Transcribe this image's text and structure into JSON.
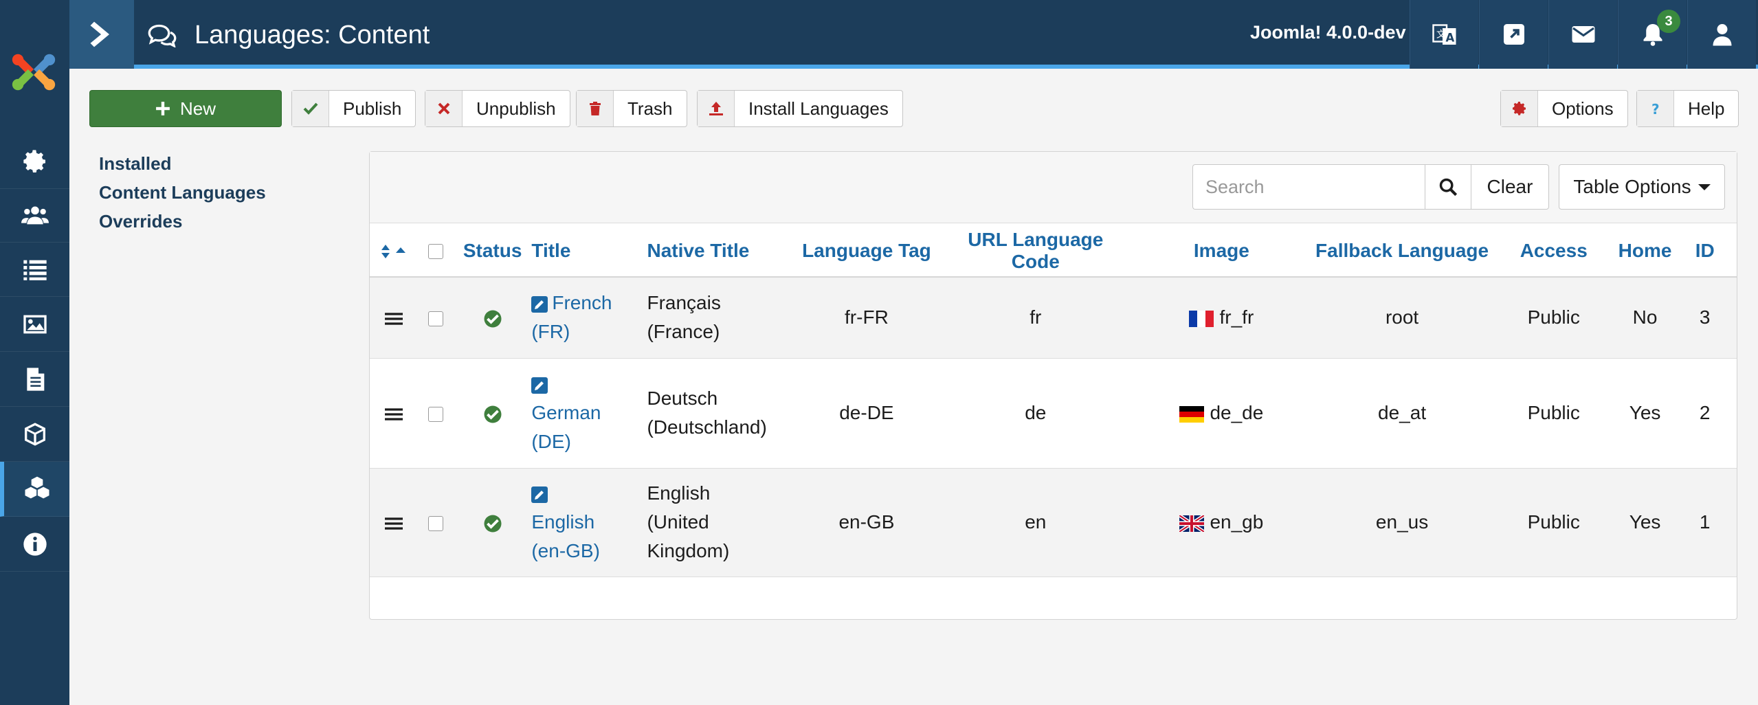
{
  "header": {
    "title": "Languages: Content",
    "version": "Joomla! 4.0.0-dev",
    "notification_count": "3",
    "accent_color": "#4aa6e8",
    "bg_color": "#1c3d5a"
  },
  "sidebar": {
    "items": [
      {
        "icon": "gear-icon"
      },
      {
        "icon": "users-icon"
      },
      {
        "icon": "list-icon"
      },
      {
        "icon": "image-icon"
      },
      {
        "icon": "document-icon"
      },
      {
        "icon": "cube-icon"
      },
      {
        "icon": "cubes-icon",
        "active": true
      },
      {
        "icon": "info-icon"
      }
    ]
  },
  "toolbar": {
    "new_label": "New",
    "publish_label": "Publish",
    "unpublish_label": "Unpublish",
    "trash_label": "Trash",
    "install_label": "Install Languages",
    "options_label": "Options",
    "help_label": "Help"
  },
  "submenu": {
    "installed": "Installed",
    "content_languages": "Content Languages",
    "overrides": "Overrides"
  },
  "filters": {
    "search_placeholder": "Search",
    "clear_label": "Clear",
    "table_options_label": "Table Options"
  },
  "table": {
    "headers": {
      "status": "Status",
      "title": "Title",
      "native_title": "Native Title",
      "language_tag": "Language Tag",
      "url_code": "URL Language Code",
      "image": "Image",
      "fallback": "Fallback Language",
      "access": "Access",
      "home": "Home",
      "id": "ID"
    },
    "rows": [
      {
        "title_line1": "French",
        "title_line2": "(FR)",
        "native_line1": "Français",
        "native_line2": "(France)",
        "native_line3": "",
        "tag": "fr-FR",
        "url_code": "fr",
        "image": "fr_fr",
        "fallback": "root",
        "access": "Public",
        "home": "No",
        "id": "3"
      },
      {
        "title_line1": "German",
        "title_line2": "(DE)",
        "native_line1": "Deutsch",
        "native_line2": "(Deutschland)",
        "native_line3": "",
        "tag": "de-DE",
        "url_code": "de",
        "image": "de_de",
        "fallback": "de_at",
        "access": "Public",
        "home": "Yes",
        "id": "2"
      },
      {
        "title_line1": "English",
        "title_line2": "(en-GB)",
        "native_line1": "English",
        "native_line2": "(United",
        "native_line3": "Kingdom)",
        "tag": "en-GB",
        "url_code": "en",
        "image": "en_gb",
        "fallback": "en_us",
        "access": "Public",
        "home": "Yes",
        "id": "1"
      }
    ]
  }
}
